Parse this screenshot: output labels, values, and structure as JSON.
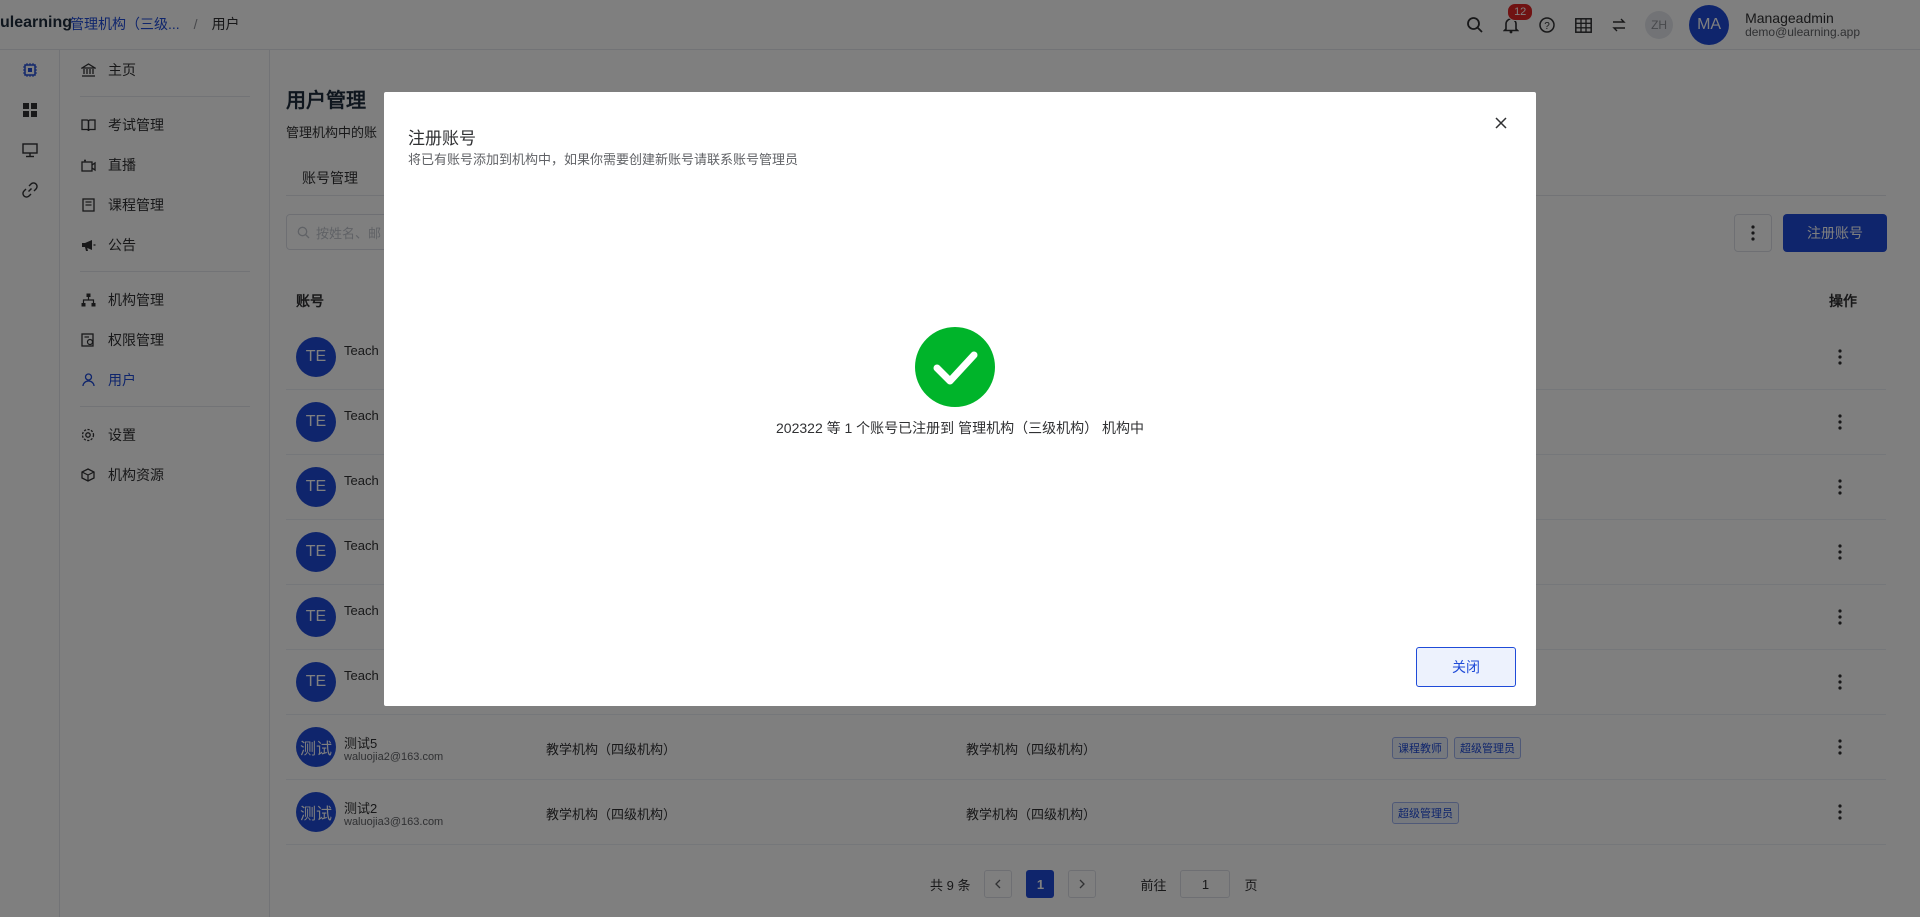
{
  "header": {
    "brand": "ulearning",
    "breadcrumb_org": "管理机构（三级...",
    "breadcrumb_current": "用户",
    "notification_count": "12",
    "lang_initials": "ZH",
    "user_initials": "MA",
    "user_name": "Manageadmin",
    "user_email": "demo@ulearning.app"
  },
  "sidebar": {
    "items": [
      {
        "label": "主页",
        "icon": "bank-icon"
      },
      {
        "label": "考试管理",
        "icon": "book-icon"
      },
      {
        "label": "直播",
        "icon": "live-icon"
      },
      {
        "label": "课程管理",
        "icon": "course-icon"
      },
      {
        "label": "公告",
        "icon": "megaphone-icon"
      },
      {
        "label": "机构管理",
        "icon": "org-tree-icon"
      },
      {
        "label": "权限管理",
        "icon": "permission-icon"
      },
      {
        "label": "用户",
        "icon": "user-icon"
      },
      {
        "label": "设置",
        "icon": "gear-icon"
      },
      {
        "label": "机构资源",
        "icon": "cube-icon"
      }
    ]
  },
  "main": {
    "title": "用户管理",
    "description": "管理机构中的账",
    "tab": "账号管理",
    "search_placeholder": "按姓名、邮",
    "register_button": "注册账号",
    "col_account": "账号",
    "col_actions": "操作",
    "rows": [
      {
        "avatar": "TE",
        "name": "Teach",
        "email": "",
        "org1": "",
        "org2": "",
        "tags": []
      },
      {
        "avatar": "TE",
        "name": "Teach",
        "email": "",
        "org1": "",
        "org2": "",
        "tags": []
      },
      {
        "avatar": "TE",
        "name": "Teach",
        "email": "",
        "org1": "",
        "org2": "",
        "tags": []
      },
      {
        "avatar": "TE",
        "name": "Teach",
        "email": "",
        "org1": "",
        "org2": "",
        "tags": []
      },
      {
        "avatar": "TE",
        "name": "Teach",
        "email": "",
        "org1": "",
        "org2": "",
        "tags": []
      },
      {
        "avatar": "TE",
        "name": "Teach",
        "email": "",
        "org1": "",
        "org2": "",
        "tags": []
      },
      {
        "avatar": "测试",
        "name": "测试5",
        "email": "waluojia2@163.com",
        "org1": "教学机构（四级机构）",
        "org2": "教学机构（四级机构）",
        "tags": [
          "课程教师",
          "超级管理员"
        ]
      },
      {
        "avatar": "测试",
        "name": "测试2",
        "email": "waluojia3@163.com",
        "org1": "教学机构（四级机构）",
        "org2": "教学机构（四级机构）",
        "tags": [
          "超级管理员"
        ]
      }
    ],
    "pagination": {
      "total": "共 9 条",
      "current_page": "1",
      "goto_label": "前往",
      "goto_value": "1",
      "page_unit": "页"
    }
  },
  "dialog": {
    "title": "注册账号",
    "subtitle": "将已有账号添加到机构中，如果你需要创建新账号请联系账号管理员",
    "message": "202322 等 1 个账号已注册到 管理机构（三级机构） 机构中",
    "close_button": "关闭",
    "success_color": "#00b42a"
  },
  "colors": {
    "primary": "#1f4bd8",
    "badge": "#e02424"
  }
}
